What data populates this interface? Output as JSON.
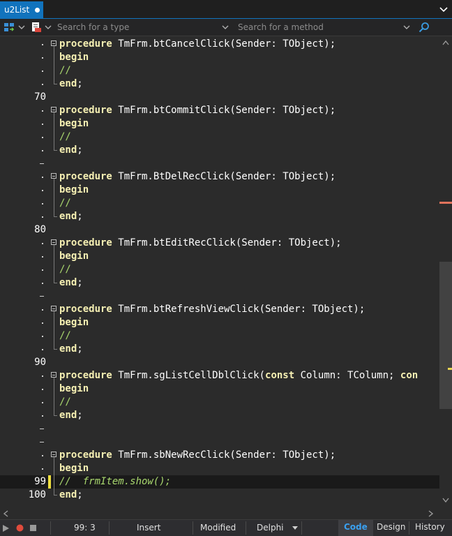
{
  "tab": {
    "label": "u2List"
  },
  "nav": {
    "type_placeholder": "Search for a type",
    "method_placeholder": "Search for a method"
  },
  "editor": {
    "lines": [
      {
        "gutter": "dot",
        "fold": "box",
        "tokens": [
          [
            "kw",
            "procedure"
          ],
          [
            "t",
            " TmFrm.btCancelClick(Sender: TObject);"
          ]
        ]
      },
      {
        "gutter": "dot",
        "fold": "line",
        "tokens": [
          [
            "kw",
            "begin"
          ]
        ]
      },
      {
        "gutter": "dot",
        "fold": "line",
        "tokens": [
          [
            "cmn",
            "//"
          ]
        ]
      },
      {
        "gutter": "dot",
        "fold": "end",
        "tokens": [
          [
            "kw",
            "end"
          ],
          [
            "t",
            ";"
          ]
        ]
      },
      {
        "gutter": "70",
        "fold": "",
        "tokens": []
      },
      {
        "gutter": "dot",
        "fold": "box",
        "tokens": [
          [
            "kw",
            "procedure"
          ],
          [
            "t",
            " TmFrm.btCommitClick(Sender: TObject);"
          ]
        ]
      },
      {
        "gutter": "dot",
        "fold": "line",
        "tokens": [
          [
            "kw",
            "begin"
          ]
        ]
      },
      {
        "gutter": "dot",
        "fold": "line",
        "tokens": [
          [
            "cmn",
            "//"
          ]
        ]
      },
      {
        "gutter": "dot",
        "fold": "end",
        "tokens": [
          [
            "kw",
            "end"
          ],
          [
            "t",
            ";"
          ]
        ]
      },
      {
        "gutter": "dash",
        "fold": "",
        "tokens": []
      },
      {
        "gutter": "dot",
        "fold": "box",
        "tokens": [
          [
            "kw",
            "procedure"
          ],
          [
            "t",
            " TmFrm.BtDelRecClick(Sender: TObject);"
          ]
        ]
      },
      {
        "gutter": "dot",
        "fold": "line",
        "tokens": [
          [
            "kw",
            "begin"
          ]
        ]
      },
      {
        "gutter": "dot",
        "fold": "line",
        "tokens": [
          [
            "cmn",
            "//"
          ]
        ]
      },
      {
        "gutter": "dot",
        "fold": "end",
        "tokens": [
          [
            "kw",
            "end"
          ],
          [
            "t",
            ";"
          ]
        ]
      },
      {
        "gutter": "80",
        "fold": "",
        "tokens": []
      },
      {
        "gutter": "dot",
        "fold": "box",
        "tokens": [
          [
            "kw",
            "procedure"
          ],
          [
            "t",
            " TmFrm.btEditRecClick(Sender: TObject);"
          ]
        ]
      },
      {
        "gutter": "dot",
        "fold": "line",
        "tokens": [
          [
            "kw",
            "begin"
          ]
        ]
      },
      {
        "gutter": "dot",
        "fold": "line",
        "tokens": [
          [
            "cmn",
            "//"
          ]
        ]
      },
      {
        "gutter": "dot",
        "fold": "end",
        "tokens": [
          [
            "kw",
            "end"
          ],
          [
            "t",
            ";"
          ]
        ]
      },
      {
        "gutter": "dash",
        "fold": "",
        "tokens": []
      },
      {
        "gutter": "dot",
        "fold": "box",
        "tokens": [
          [
            "kw",
            "procedure"
          ],
          [
            "t",
            " TmFrm.btRefreshViewClick(Sender: TObject);"
          ]
        ]
      },
      {
        "gutter": "dot",
        "fold": "line",
        "tokens": [
          [
            "kw",
            "begin"
          ]
        ]
      },
      {
        "gutter": "dot",
        "fold": "line",
        "tokens": [
          [
            "cmn",
            "//"
          ]
        ]
      },
      {
        "gutter": "dot",
        "fold": "end",
        "tokens": [
          [
            "kw",
            "end"
          ],
          [
            "t",
            ";"
          ]
        ]
      },
      {
        "gutter": "90",
        "fold": "",
        "tokens": []
      },
      {
        "gutter": "dot",
        "fold": "box",
        "tokens": [
          [
            "kw",
            "procedure"
          ],
          [
            "t",
            " TmFrm.sgListCellDblClick("
          ],
          [
            "kw",
            "const"
          ],
          [
            "t",
            " Column: TColumn; "
          ],
          [
            "kw",
            "con"
          ]
        ]
      },
      {
        "gutter": "dot",
        "fold": "line",
        "tokens": [
          [
            "kw",
            "begin"
          ]
        ]
      },
      {
        "gutter": "dot",
        "fold": "line",
        "tokens": [
          [
            "cmn",
            "//"
          ]
        ]
      },
      {
        "gutter": "dot",
        "fold": "end",
        "tokens": [
          [
            "kw",
            "end"
          ],
          [
            "t",
            ";"
          ]
        ]
      },
      {
        "gutter": "dash",
        "fold": "",
        "tokens": []
      },
      {
        "gutter": "dash",
        "fold": "",
        "tokens": []
      },
      {
        "gutter": "dot",
        "fold": "box",
        "tokens": [
          [
            "kw",
            "procedure"
          ],
          [
            "t",
            " TmFrm.sbNewRecClick(Sender: TObject);"
          ]
        ]
      },
      {
        "gutter": "dot",
        "fold": "line",
        "tokens": [
          [
            "kw",
            "begin"
          ]
        ]
      },
      {
        "gutter": "99",
        "fold": "line",
        "current": true,
        "modified": true,
        "tokens": [
          [
            "cm",
            "//  frmItem.show();"
          ]
        ]
      },
      {
        "gutter": "100",
        "fold": "end",
        "tokens": [
          [
            "kw",
            "end"
          ],
          [
            "t",
            ";"
          ]
        ]
      }
    ]
  },
  "status": {
    "position": "99:  3",
    "insert_mode": "Insert",
    "modified": "Modified",
    "language": "Delphi",
    "views": [
      "Code",
      "Design",
      "History"
    ]
  },
  "colors": {
    "accent": "#1173bd",
    "keyword": "#f6f0b3",
    "comment": "#a9d86e",
    "active_view": "#3aa0f0"
  }
}
